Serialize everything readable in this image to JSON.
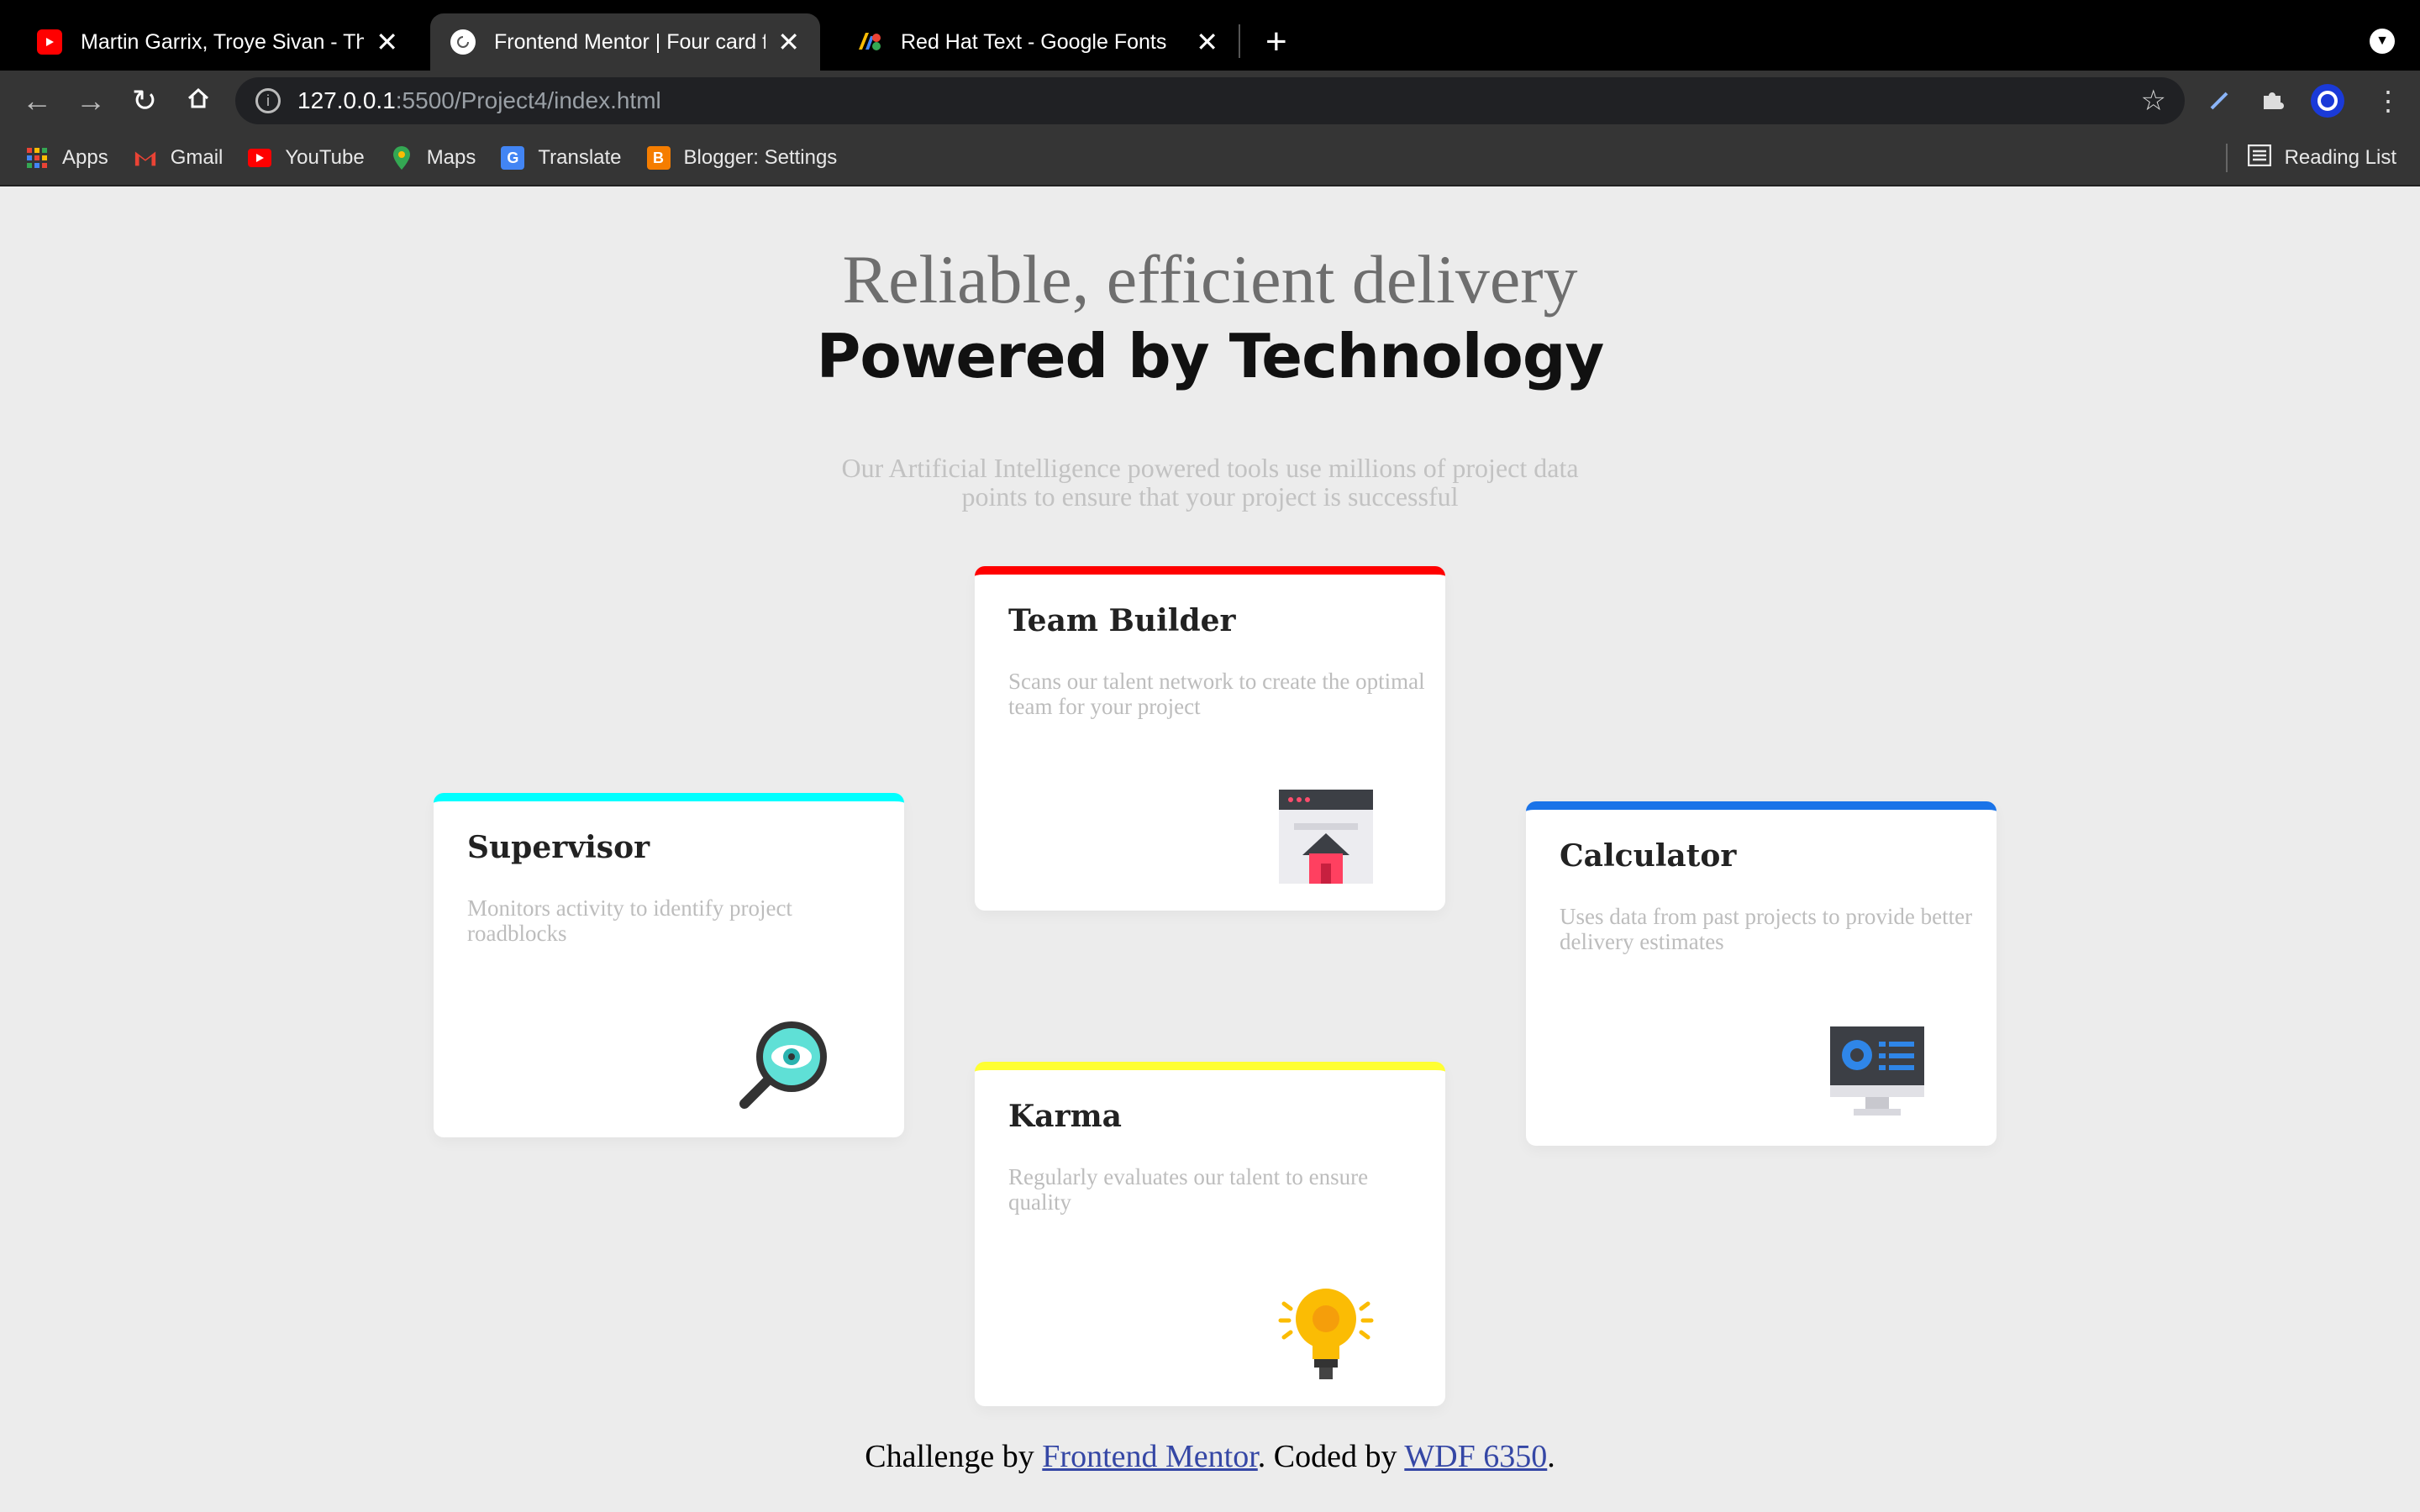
{
  "browser": {
    "tabs": [
      {
        "title": "Martin Garrix, Troye Sivan - The",
        "icon": "youtube-icon"
      },
      {
        "title": "Frontend Mentor | Four card fe",
        "icon": "loading-icon"
      },
      {
        "title": "Red Hat Text - Google Fonts",
        "icon": "google-fonts-icon"
      }
    ],
    "address": {
      "host": "127.0.0.1",
      "path": ":5500/Project4/index.html"
    },
    "bookmarks": [
      {
        "label": "Apps",
        "icon": "apps-grid-icon"
      },
      {
        "label": "Gmail",
        "icon": "gmail-icon"
      },
      {
        "label": "YouTube",
        "icon": "youtube-icon"
      },
      {
        "label": "Maps",
        "icon": "maps-pin-icon"
      },
      {
        "label": "Translate",
        "icon": "translate-icon"
      },
      {
        "label": "Blogger: Settings",
        "icon": "blogger-icon"
      }
    ],
    "reading_list": "Reading List"
  },
  "page": {
    "headline_light": "Reliable, efficient delivery",
    "headline_bold": "Powered by Technology",
    "intro": "Our Artificial Intelligence powered tools use millions of project data points to ensure that your project is successful",
    "cards": [
      {
        "title": "Supervisor",
        "text": "Monitors activity to identify project roadblocks",
        "accent": "#00ffff",
        "icon": "magnifier-eye-icon"
      },
      {
        "title": "Team Builder",
        "text": "Scans our talent network to create the optimal team for your project",
        "accent": "#ff0000",
        "icon": "team-builder-window-icon"
      },
      {
        "title": "Karma",
        "text": "Regularly evaluates our talent to ensure quality",
        "accent": "#ffff33",
        "icon": "lightbulb-icon"
      },
      {
        "title": "Calculator",
        "text": "Uses data from past projects to provide better delivery estimates",
        "accent": "#1a73e8",
        "icon": "calculator-monitor-icon"
      }
    ],
    "footer": {
      "prefix": "Challenge by ",
      "link1": "Frontend Mentor",
      "middle": ". Coded by ",
      "link2": "WDF 6350",
      "suffix": "."
    }
  }
}
